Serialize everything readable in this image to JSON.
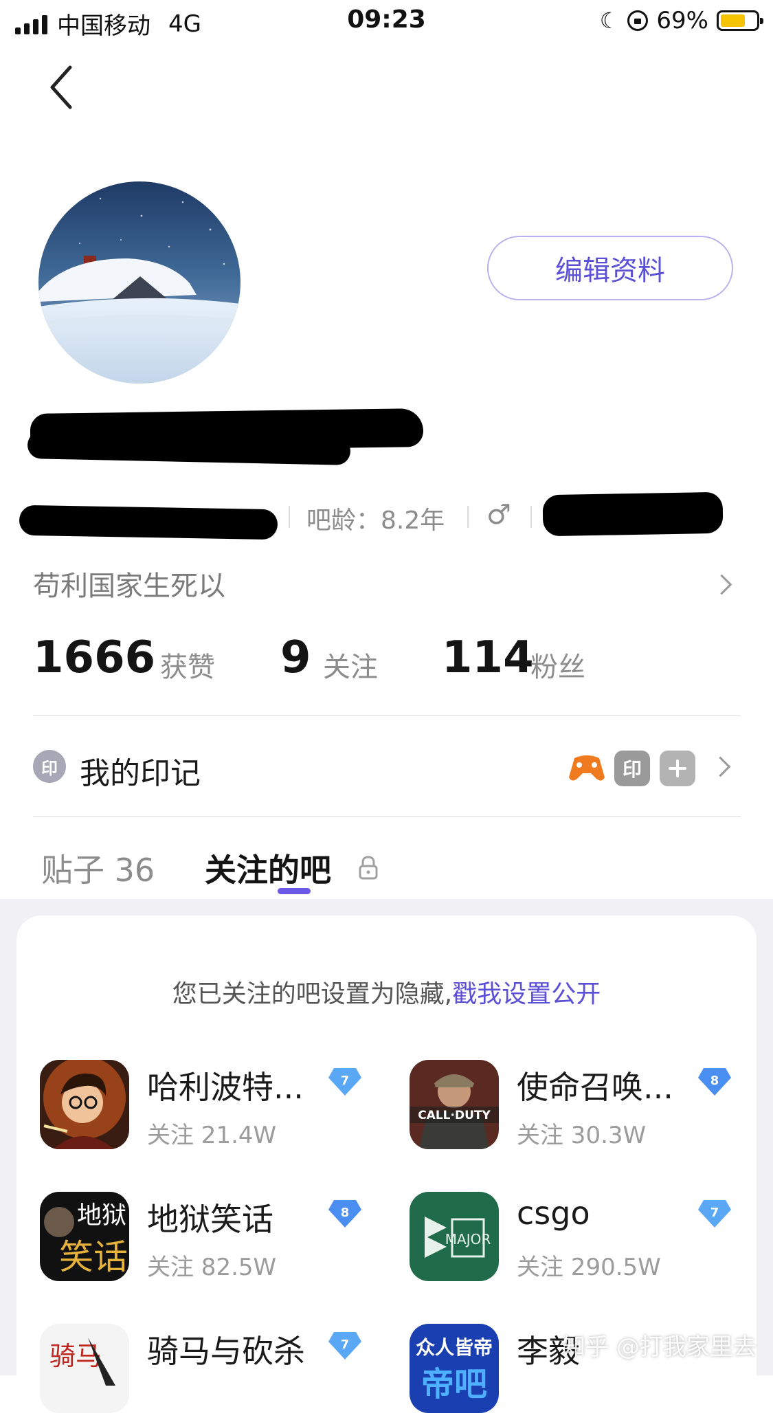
{
  "status_bar": {
    "carrier": "中国移动",
    "network": "4G",
    "time": "09:23",
    "battery_percent": "69%",
    "battery_level": 0.69
  },
  "profile": {
    "edit_button": "编辑资料",
    "age_label": "吧龄：8.2年",
    "bio": "苟利国家生死以",
    "stats": [
      {
        "value": "1666",
        "label": "获赞"
      },
      {
        "value": "9",
        "label": "关注"
      },
      {
        "value": "114",
        "label": "粉丝"
      }
    ]
  },
  "marks": {
    "icon_text": "印",
    "label": "我的印记",
    "badge_text": "印"
  },
  "tabs": [
    {
      "label": "贴子 36"
    },
    {
      "label": "关注的吧"
    }
  ],
  "followed": {
    "notice_text": "您已关注的吧设置为隐藏,",
    "notice_link": "戳我设置公开",
    "forums": [
      {
        "name": "哈利波特...",
        "followers": "关注 21.4W",
        "level": "7",
        "level_color": "#5aa7f5"
      },
      {
        "name": "使命召唤...",
        "followers": "关注 30.3W",
        "level": "8",
        "level_color": "#4a8ef2"
      },
      {
        "name": "地狱笑话",
        "followers": "关注 82.5W",
        "level": "8",
        "level_color": "#4a8ef2"
      },
      {
        "name": "csgo",
        "followers": "关注 290.5W",
        "level": "7",
        "level_color": "#5aa7f5"
      },
      {
        "name": "骑马与砍杀",
        "followers": "",
        "level": "7",
        "level_color": "#5aa7f5"
      },
      {
        "name": "李毅",
        "followers": "",
        "level": "",
        "level_color": "#5aa7f5"
      }
    ]
  },
  "watermark": "知乎 @打我家里去"
}
